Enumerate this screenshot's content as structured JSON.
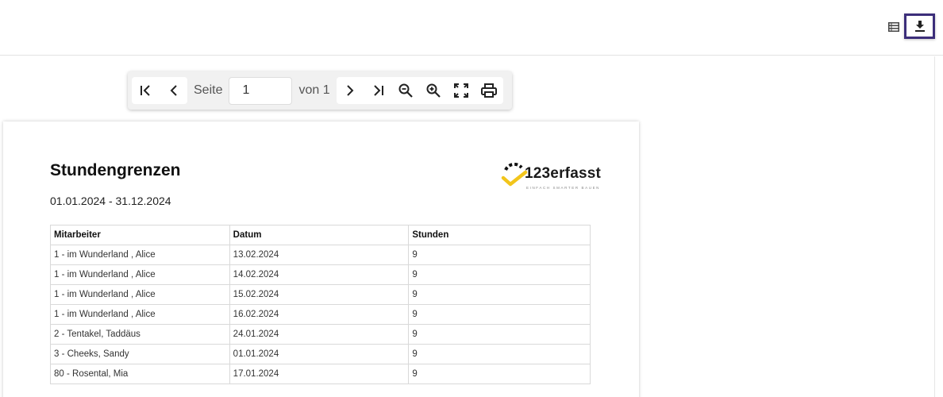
{
  "toolbar": {
    "page_label": "Seite",
    "page_value": "1",
    "of_label": "von 1",
    "icons": [
      "first-page-icon",
      "previous-page-icon",
      "next-page-icon",
      "last-page-icon",
      "zoom-out-icon",
      "zoom-in-icon",
      "fullscreen-icon",
      "print-icon"
    ]
  },
  "top_actions": {
    "icons": [
      "list-view-icon",
      "download-icon"
    ],
    "accent": "#3c2e7a"
  },
  "report": {
    "title": "Stundengrenzen",
    "date_range": "01.01.2024 - 31.12.2024",
    "logo": {
      "name": "123erfasst",
      "tagline": "EINFACH SMARTER BAUEN",
      "accent": "#f2c51b"
    },
    "columns": [
      "Mitarbeiter",
      "Datum",
      "Stunden"
    ],
    "rows": [
      [
        "1 - im Wunderland , Alice",
        "13.02.2024",
        "9"
      ],
      [
        "1 - im Wunderland , Alice",
        "14.02.2024",
        "9"
      ],
      [
        "1 - im Wunderland , Alice",
        "15.02.2024",
        "9"
      ],
      [
        "1 - im Wunderland , Alice",
        "16.02.2024",
        "9"
      ],
      [
        "2 - Tentakel, Taddäus",
        "24.01.2024",
        "9"
      ],
      [
        "3 - Cheeks, Sandy",
        "01.01.2024",
        "9"
      ],
      [
        "80 - Rosental, Mia",
        "17.01.2024",
        "9"
      ]
    ]
  }
}
